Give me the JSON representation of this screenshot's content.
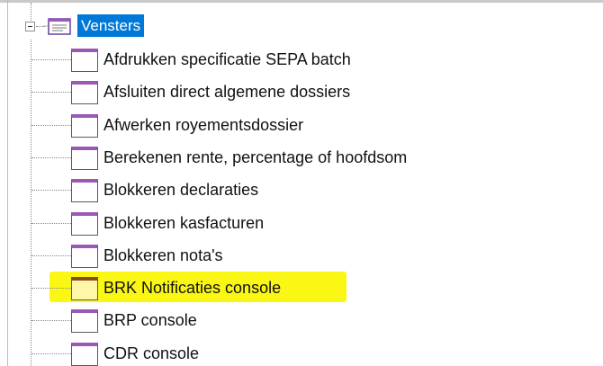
{
  "tree": {
    "root": {
      "label": "Vensters",
      "expanded": true
    },
    "items": [
      {
        "label": "Afdrukken specificatie SEPA batch",
        "highlighted": false
      },
      {
        "label": "Afsluiten direct algemene dossiers",
        "highlighted": false
      },
      {
        "label": "Afwerken royementsdossier",
        "highlighted": false
      },
      {
        "label": "Berekenen rente, percentage of hoofdsom",
        "highlighted": false
      },
      {
        "label": "Blokkeren declaraties",
        "highlighted": false
      },
      {
        "label": "Blokkeren kasfacturen",
        "highlighted": false
      },
      {
        "label": "Blokkeren nota's",
        "highlighted": false
      },
      {
        "label": "BRK Notificaties console",
        "highlighted": true
      },
      {
        "label": "BRP console",
        "highlighted": false
      },
      {
        "label": "CDR console",
        "highlighted": false
      }
    ]
  },
  "colors": {
    "selection": "#0078d7",
    "highlight": "#fbf714",
    "window_icon_accent": "#9b59b6"
  },
  "icons": {
    "root": "folder-tree-icon",
    "item": "window-icon",
    "expander": "collapse-minus-icon"
  }
}
